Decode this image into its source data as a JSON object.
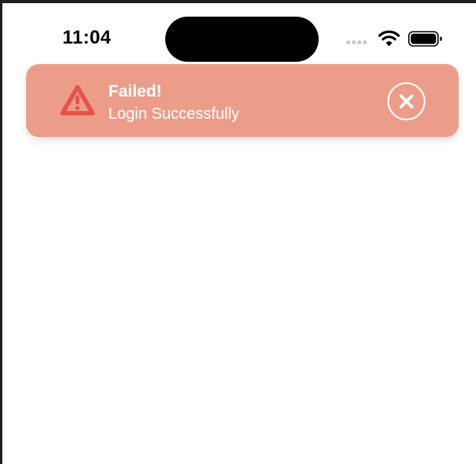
{
  "status_bar": {
    "time": "11:04",
    "icons": [
      "signal-dots-icon",
      "wifi-icon",
      "battery-icon"
    ]
  },
  "toast": {
    "title": "Failed!",
    "message": "Login Successfully",
    "icon": "warning-triangle-icon",
    "close_icon": "close-circle-icon",
    "colors": {
      "background": "#ec9d89",
      "icon": "#e5534b",
      "text": "#ffffff"
    }
  }
}
